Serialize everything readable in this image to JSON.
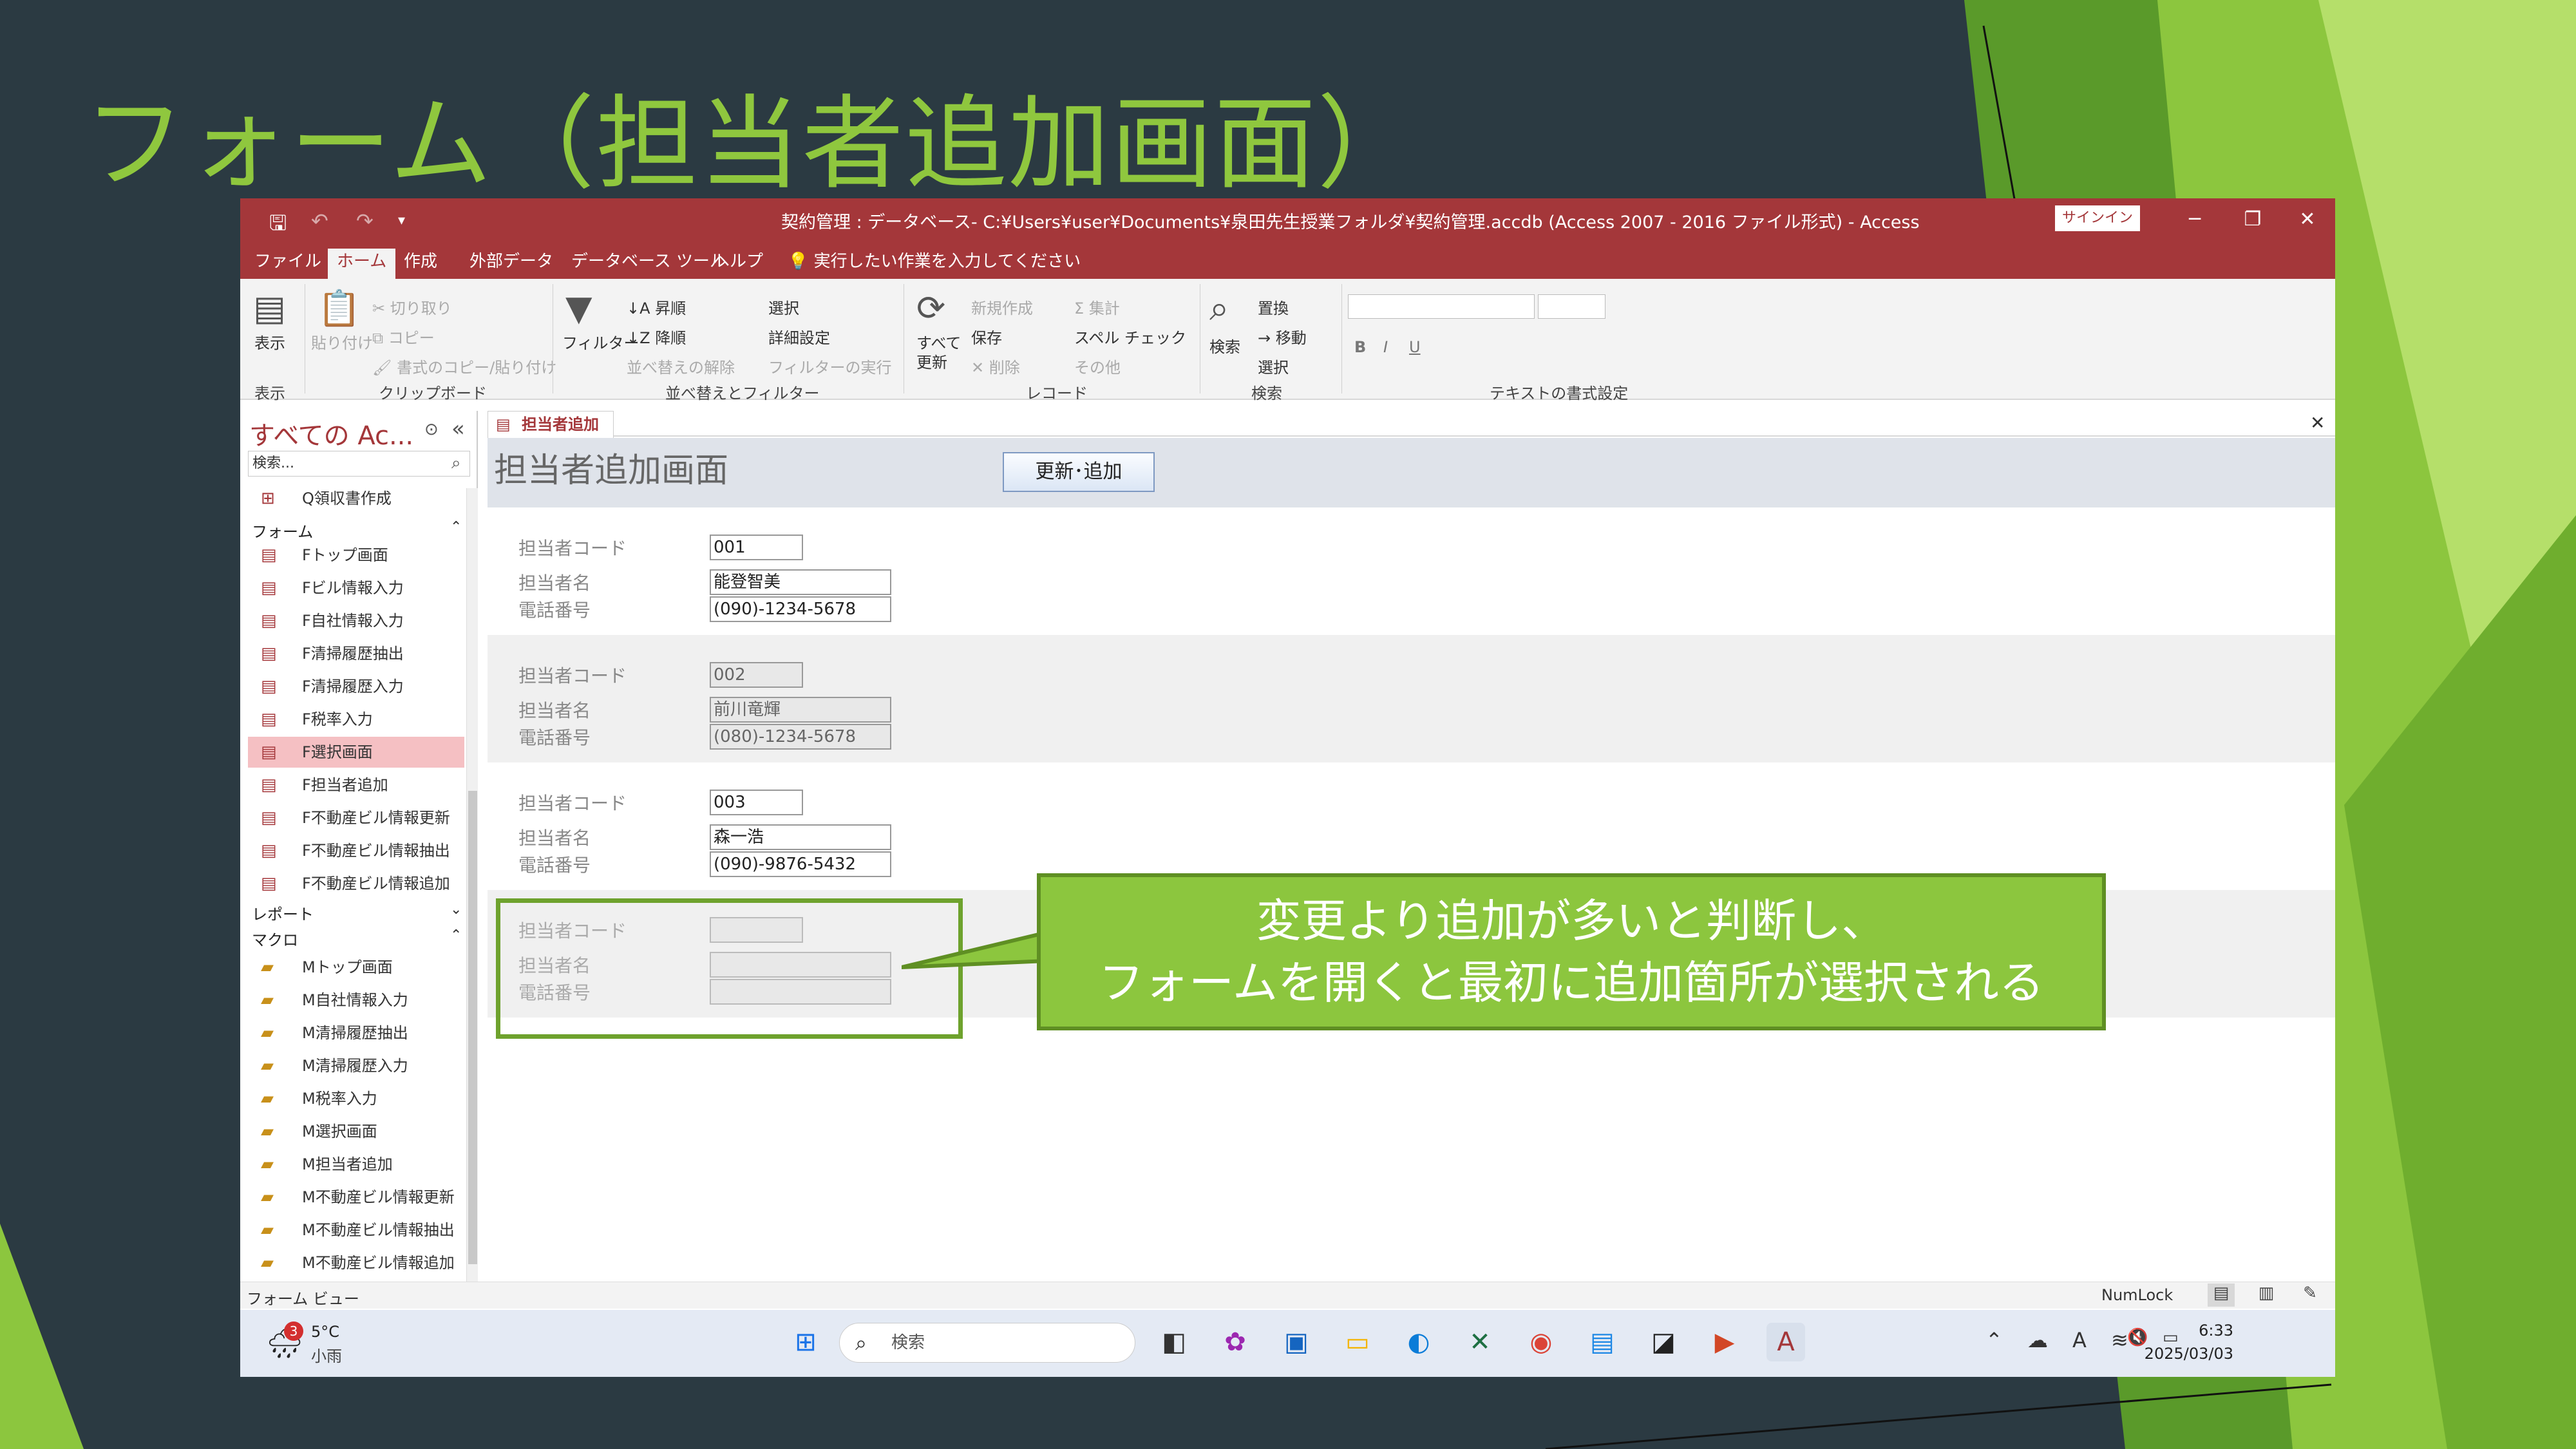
{
  "slide": {
    "title": "フォーム（担当者追加画面）"
  },
  "window": {
    "title": "契約管理 : データベース- C:¥Users¥user¥Documents¥泉田先生授業フォルダ¥契約管理.accdb (Access 2007 - 2016 ファイル形式) - Access",
    "signin": "サインイン",
    "minimize": "─",
    "restore": "❐",
    "close": "✕",
    "accent_color": "#a4373a"
  },
  "menu_tabs": [
    "ファイル",
    "ホーム",
    "作成",
    "外部データ",
    "データベース ツール",
    "ヘルプ",
    "実行したい作業を入力してください"
  ],
  "ribbon": {
    "view": "表示",
    "view_sub": "表示",
    "paste": "貼り付け",
    "cut": "切り取り",
    "copy": "コピー",
    "format_painter": "書式のコピー/貼り付け",
    "clipboard": "クリップボード",
    "filter": "フィルター",
    "asc": "昇順",
    "desc": "降順",
    "clear_sort": "並べ替えの解除",
    "select_filter": "選択",
    "advanced": "詳細設定",
    "toggle_filter": "フィルターの実行",
    "sort_filter": "並べ替えとフィルター",
    "refresh": "すべて",
    "refresh2": "更新",
    "new": "新規作成",
    "save": "保存",
    "delete": "削除",
    "totals": "集計",
    "spell": "スペル チェック",
    "more": "その他",
    "records": "レコード",
    "find": "検索",
    "replace": "置換",
    "goto": "移動",
    "select": "選択",
    "find_group": "検索",
    "text_format": "テキストの書式設定",
    "bold": "B",
    "italic": "I",
    "underline": "U"
  },
  "nav": {
    "title": "すべての Ac...",
    "search_placeholder": "検索...",
    "top_item": "Q領収書作成",
    "forms_header": "フォーム",
    "forms": [
      "Fトップ画面",
      "Fビル情報入力",
      "F自社情報入力",
      "F清掃履歴抽出",
      "F清掃履歴入力",
      "F税率入力",
      "F選択画面",
      "F担当者追加",
      "F不動産ビル情報更新",
      "F不動産ビル情報抽出",
      "F不動産ビル情報追加"
    ],
    "selected_index": 6,
    "reports_header": "レポート",
    "macros_header": "マクロ",
    "macros": [
      "Mトップ画面",
      "M自社情報入力",
      "M清掃履歴抽出",
      "M清掃履歴入力",
      "M税率入力",
      "M選択画面",
      "M担当者追加",
      "M不動産ビル情報更新",
      "M不動産ビル情報抽出",
      "M不動産ビル情報追加"
    ]
  },
  "doc_tab": "担当者追加",
  "form": {
    "title": "担当者追加画面",
    "button": "更新･追加",
    "labels": {
      "code": "担当者コード",
      "name": "担当者名",
      "phone": "電話番号"
    },
    "records": [
      {
        "code": "001",
        "name": "能登智美",
        "phone": "(090)-1234-5678"
      },
      {
        "code": "002",
        "name": "前川竜輝",
        "phone": "(080)-1234-5678"
      },
      {
        "code": "003",
        "name": "森一浩",
        "phone": "(090)-9876-5432"
      },
      {
        "code": "",
        "name": "",
        "phone": ""
      }
    ]
  },
  "callout": {
    "line1": "変更より追加が多いと判断し、",
    "line2": "フォームを開くと最初に追加箇所が選択される",
    "color": "#8cc63e"
  },
  "status": {
    "left": "フォーム ビュー",
    "numlock": "NumLock"
  },
  "taskbar": {
    "weather_temp": "5°C",
    "weather_desc": "小雨",
    "weather_badge": "3",
    "search": "検索",
    "time": "6:33",
    "date": "2025/03/03"
  }
}
